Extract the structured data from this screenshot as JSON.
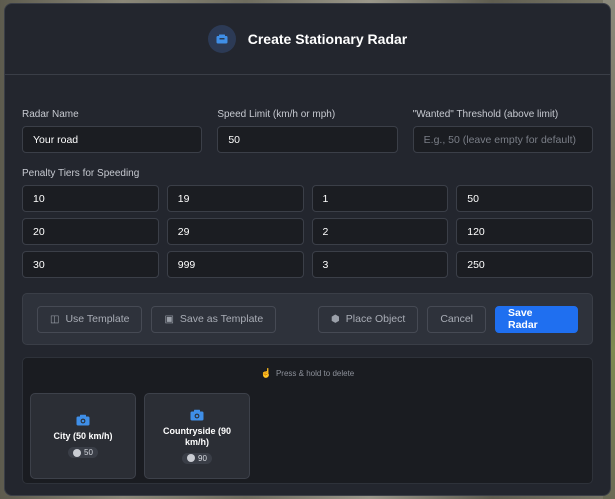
{
  "header": {
    "title": "Create Stationary Radar",
    "icon": "radar-camera-icon"
  },
  "fields": {
    "name_label": "Radar Name",
    "name_value": "Your road",
    "speed_label": "Speed Limit (km/h or mph)",
    "speed_value": "50",
    "wanted_label": "\"Wanted\" Threshold (above limit)",
    "wanted_placeholder": "E.g., 50 (leave empty for default)"
  },
  "tiers": {
    "label": "Penalty Tiers for Speeding",
    "rows": [
      [
        "10",
        "19",
        "1",
        "50"
      ],
      [
        "20",
        "29",
        "2",
        "120"
      ],
      [
        "30",
        "999",
        "3",
        "250"
      ]
    ]
  },
  "actions": {
    "use_template": "Use Template",
    "save_template": "Save as Template",
    "place_object": "Place Object",
    "cancel": "Cancel",
    "save_radar": "Save Radar"
  },
  "templates": {
    "hint": "Press & hold to delete",
    "items": [
      {
        "name": "City (50 km/h)",
        "limit": "50"
      },
      {
        "name": "Countryside (90 km/h)",
        "limit": "90"
      }
    ]
  },
  "colors": {
    "accent": "#1f6ff0",
    "background": "#23262e",
    "icon_blue": "#3f8fe8"
  }
}
